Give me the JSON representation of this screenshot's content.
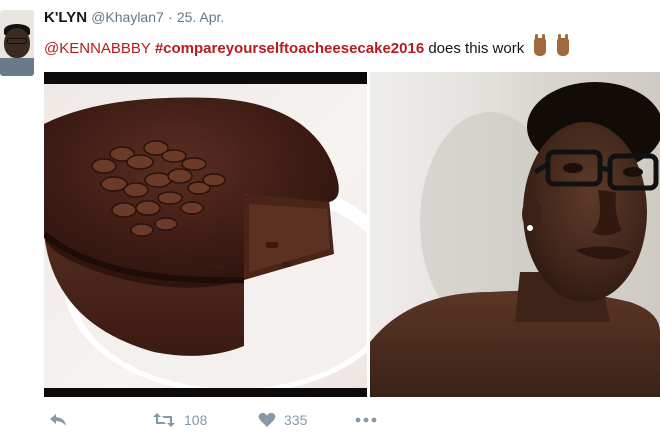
{
  "tweet": {
    "display_name": "K'LYN",
    "handle": "@Khaylan7",
    "separator": "·",
    "date": "25. Apr.",
    "mention": "@KENNABBBY",
    "hashtag": "#compareyourselftoacheesecake2016",
    "body": "does this work",
    "emoji": [
      "hand-gesture",
      "hand-gesture"
    ]
  },
  "media": {
    "left_subject": "chocolate cheesecake",
    "right_subject": "selfie"
  },
  "actions": {
    "retweets": "108",
    "likes": "335",
    "icons": [
      "reply-icon",
      "retweet-icon",
      "heart-icon",
      "more-icon"
    ]
  },
  "colors": {
    "link": "#b71c1c",
    "name": "#14171a",
    "muted": "#657786",
    "action": "#8899a6"
  }
}
